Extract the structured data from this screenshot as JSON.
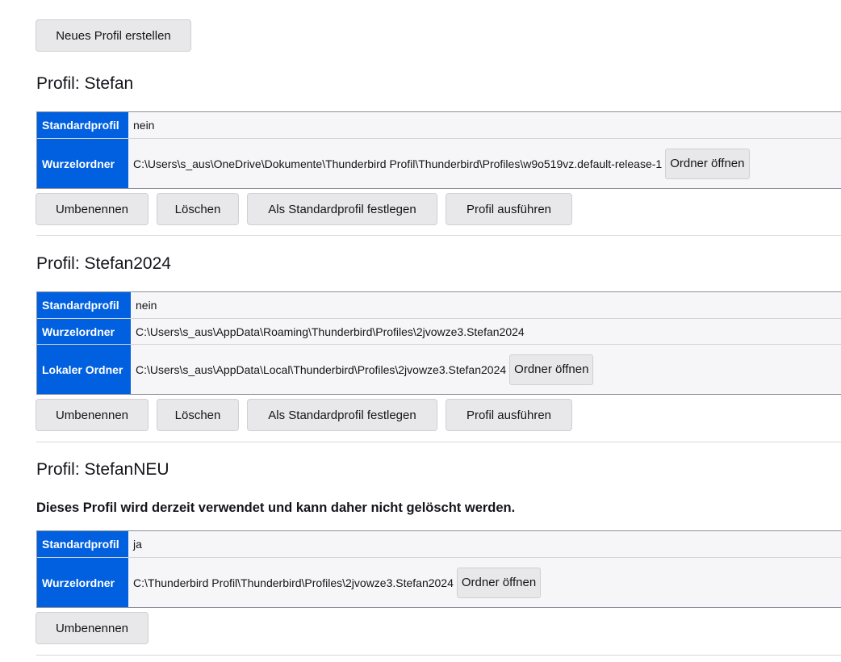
{
  "top": {
    "new_profile_label": "Neues Profil erstellen"
  },
  "profiles": [
    {
      "heading": "Profil: Stefan",
      "rows": [
        {
          "label": "Standardprofil",
          "value": "nein"
        },
        {
          "label": "Wurzelordner",
          "value": "C:\\Users\\s_aus\\OneDrive\\Dokumente\\Thunderbird Profil\\Thunderbird\\Profiles\\w9o519vz.default-release-1",
          "button": "Ordner öffnen"
        }
      ],
      "actions": [
        "Umbenennen",
        "Löschen",
        "Als Standardprofil festlegen",
        "Profil ausführen"
      ]
    },
    {
      "heading": "Profil: Stefan2024",
      "rows": [
        {
          "label": "Standardprofil",
          "value": "nein"
        },
        {
          "label": "Wurzelordner",
          "value": "C:\\Users\\s_aus\\AppData\\Roaming\\Thunderbird\\Profiles\\2jvowze3.Stefan2024"
        },
        {
          "label": "Lokaler Ordner",
          "value": "C:\\Users\\s_aus\\AppData\\Local\\Thunderbird\\Profiles\\2jvowze3.Stefan2024",
          "button": "Ordner öffnen"
        }
      ],
      "actions": [
        "Umbenennen",
        "Löschen",
        "Als Standardprofil festlegen",
        "Profil ausführen"
      ]
    },
    {
      "heading": "Profil: StefanNEU",
      "notice": "Dieses Profil wird derzeit verwendet und kann daher nicht gelöscht werden.",
      "rows": [
        {
          "label": "Standardprofil",
          "value": "ja"
        },
        {
          "label": "Wurzelordner",
          "value": "C:\\Thunderbird Profil\\Thunderbird\\Profiles\\2jvowze3.Stefan2024",
          "button": "Ordner öffnen"
        }
      ],
      "actions": [
        "Umbenennen"
      ]
    }
  ]
}
